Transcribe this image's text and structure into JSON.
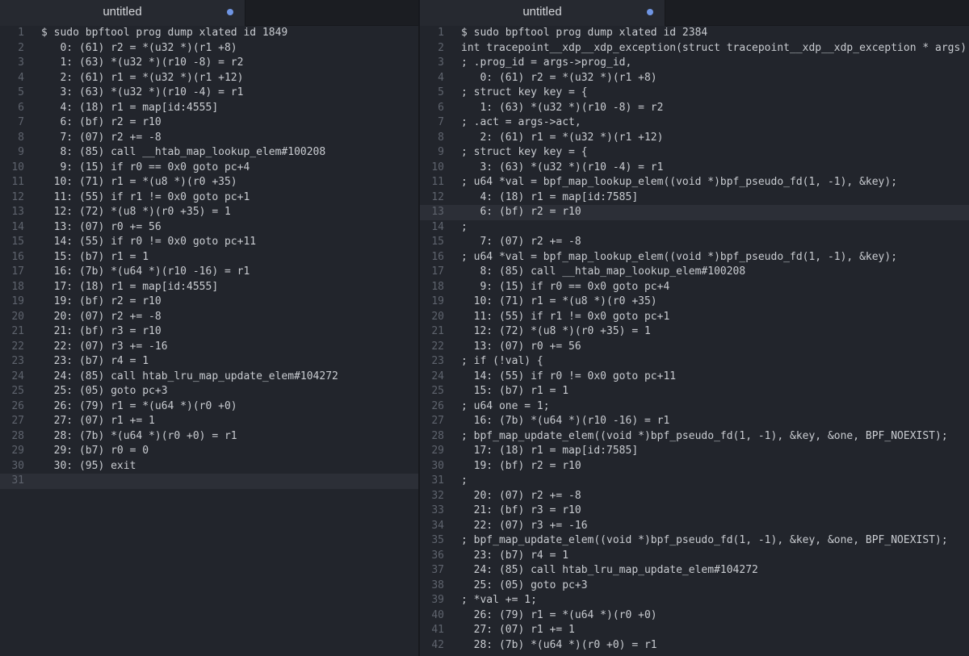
{
  "left_pane": {
    "tab_title": "untitled",
    "current_line": 31,
    "lines": [
      "$ sudo bpftool prog dump xlated id 1849",
      "   0: (61) r2 = *(u32 *)(r1 +8)",
      "   1: (63) *(u32 *)(r10 -8) = r2",
      "   2: (61) r1 = *(u32 *)(r1 +12)",
      "   3: (63) *(u32 *)(r10 -4) = r1",
      "   4: (18) r1 = map[id:4555]",
      "   6: (bf) r2 = r10",
      "   7: (07) r2 += -8",
      "   8: (85) call __htab_map_lookup_elem#100208",
      "   9: (15) if r0 == 0x0 goto pc+4",
      "  10: (71) r1 = *(u8 *)(r0 +35)",
      "  11: (55) if r1 != 0x0 goto pc+1",
      "  12: (72) *(u8 *)(r0 +35) = 1",
      "  13: (07) r0 += 56",
      "  14: (55) if r0 != 0x0 goto pc+11",
      "  15: (b7) r1 = 1",
      "  16: (7b) *(u64 *)(r10 -16) = r1",
      "  17: (18) r1 = map[id:4555]",
      "  19: (bf) r2 = r10",
      "  20: (07) r2 += -8",
      "  21: (bf) r3 = r10",
      "  22: (07) r3 += -16",
      "  23: (b7) r4 = 1",
      "  24: (85) call htab_lru_map_update_elem#104272",
      "  25: (05) goto pc+3",
      "  26: (79) r1 = *(u64 *)(r0 +0)",
      "  27: (07) r1 += 1",
      "  28: (7b) *(u64 *)(r0 +0) = r1",
      "  29: (b7) r0 = 0",
      "  30: (95) exit",
      ""
    ]
  },
  "right_pane": {
    "tab_title": "untitled",
    "current_line": 13,
    "lines": [
      "$ sudo bpftool prog dump xlated id 2384",
      "int tracepoint__xdp__xdp_exception(struct tracepoint__xdp__xdp_exception * args):",
      "; .prog_id = args->prog_id,",
      "   0: (61) r2 = *(u32 *)(r1 +8)",
      "; struct key key = {",
      "   1: (63) *(u32 *)(r10 -8) = r2",
      "; .act = args->act,",
      "   2: (61) r1 = *(u32 *)(r1 +12)",
      "; struct key key = {",
      "   3: (63) *(u32 *)(r10 -4) = r1",
      "; u64 *val = bpf_map_lookup_elem((void *)bpf_pseudo_fd(1, -1), &key);",
      "   4: (18) r1 = map[id:7585]",
      "   6: (bf) r2 = r10",
      ";",
      "   7: (07) r2 += -8",
      "; u64 *val = bpf_map_lookup_elem((void *)bpf_pseudo_fd(1, -1), &key);",
      "   8: (85) call __htab_map_lookup_elem#100208",
      "   9: (15) if r0 == 0x0 goto pc+4",
      "  10: (71) r1 = *(u8 *)(r0 +35)",
      "  11: (55) if r1 != 0x0 goto pc+1",
      "  12: (72) *(u8 *)(r0 +35) = 1",
      "  13: (07) r0 += 56",
      "; if (!val) {",
      "  14: (55) if r0 != 0x0 goto pc+11",
      "  15: (b7) r1 = 1",
      "; u64 one = 1;",
      "  16: (7b) *(u64 *)(r10 -16) = r1",
      "; bpf_map_update_elem((void *)bpf_pseudo_fd(1, -1), &key, &one, BPF_NOEXIST);",
      "  17: (18) r1 = map[id:7585]",
      "  19: (bf) r2 = r10",
      ";",
      "  20: (07) r2 += -8",
      "  21: (bf) r3 = r10",
      "  22: (07) r3 += -16",
      "; bpf_map_update_elem((void *)bpf_pseudo_fd(1, -1), &key, &one, BPF_NOEXIST);",
      "  23: (b7) r4 = 1",
      "  24: (85) call htab_lru_map_update_elem#104272",
      "  25: (05) goto pc+3",
      "; *val += 1;",
      "  26: (79) r1 = *(u64 *)(r0 +0)",
      "  27: (07) r1 += 1",
      "  28: (7b) *(u64 *)(r0 +0) = r1"
    ]
  }
}
